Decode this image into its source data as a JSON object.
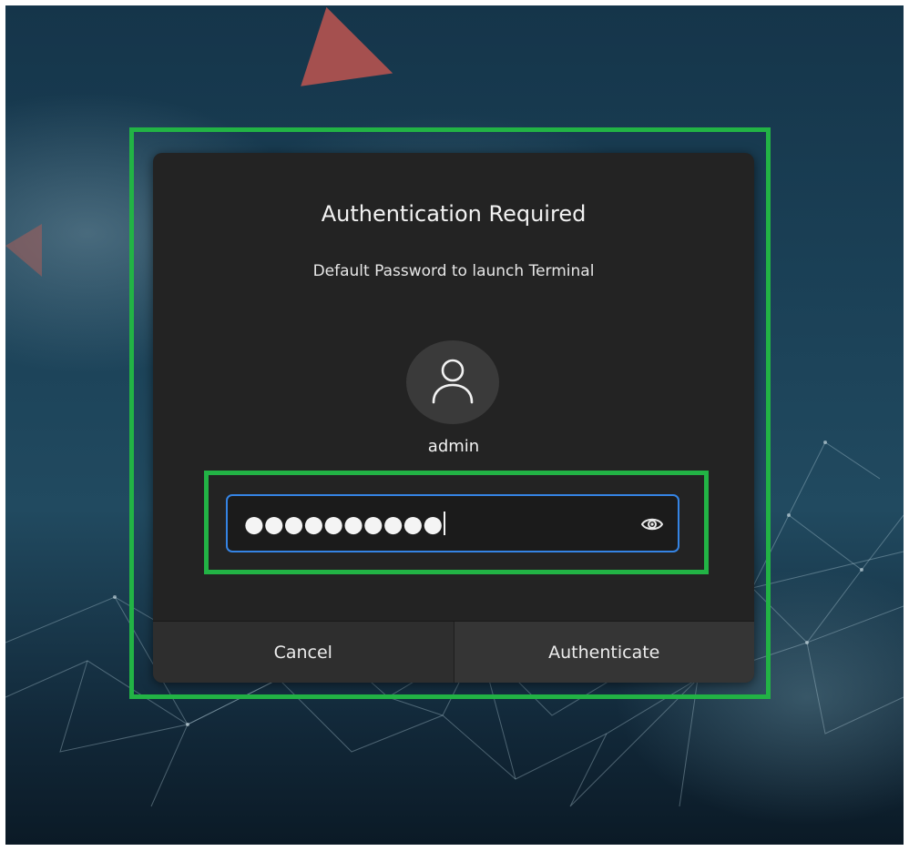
{
  "dialog": {
    "title": "Authentication Required",
    "message": "Default Password to launch Terminal",
    "avatar_icon": "user-icon",
    "username": "admin",
    "password_field": {
      "masked_value": "●●●●●●●●●●",
      "reveal_icon": "eye-icon"
    },
    "buttons": {
      "cancel_label": "Cancel",
      "authenticate_label": "Authenticate"
    }
  },
  "colors": {
    "highlight": "#22b345",
    "focus_border": "#3584e4",
    "dialog_bg": "#232323"
  }
}
